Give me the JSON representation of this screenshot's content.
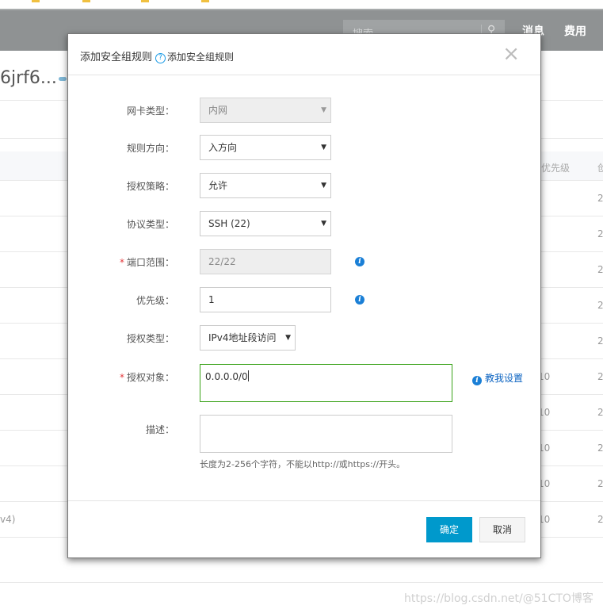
{
  "topnav": {
    "search_placeholder": "搜索",
    "links": [
      "消息",
      "费用"
    ]
  },
  "background": {
    "title_fragment": "6jrf6...",
    "table_header": [
      "优先级",
      "创"
    ],
    "priority_cells": [
      "10",
      "10",
      "10",
      "10",
      "10"
    ],
    "date_cells": [
      "2",
      "2",
      "2",
      "2",
      "2",
      "2",
      "2",
      "2",
      "2",
      "2"
    ],
    "left_fragment": "v4)"
  },
  "modal": {
    "title": "添加安全组规则",
    "help_link": "添加安全组规则",
    "close_label": "×",
    "fields": {
      "nic_type": {
        "label": "网卡类型：",
        "value": "内网",
        "disabled": true
      },
      "direction": {
        "label": "规则方向：",
        "value": "入方向"
      },
      "policy": {
        "label": "授权策略：",
        "value": "允许"
      },
      "protocol": {
        "label": "协议类型：",
        "value": "SSH (22)"
      },
      "port_range": {
        "label": "端口范围：",
        "value": "22/22",
        "required": true,
        "disabled": true
      },
      "priority": {
        "label": "优先级：",
        "value": "1"
      },
      "auth_type": {
        "label": "授权类型：",
        "value": "IPv4地址段访问"
      },
      "auth_object": {
        "label": "授权对象：",
        "value": "0.0.0.0/0",
        "required": true
      },
      "description": {
        "label": "描述：",
        "value": "",
        "hint": "长度为2-256个字符，不能以http://或https://开头。"
      }
    },
    "teach_link": "教我设置",
    "buttons": {
      "ok": "确定",
      "cancel": "取消"
    }
  },
  "watermark": "https://blog.csdn.net/@51CTO博客",
  "colors": {
    "primary": "#0099cc",
    "focus_border": "#3aa219",
    "info": "#1a7fd6",
    "required": "#e4393c"
  }
}
